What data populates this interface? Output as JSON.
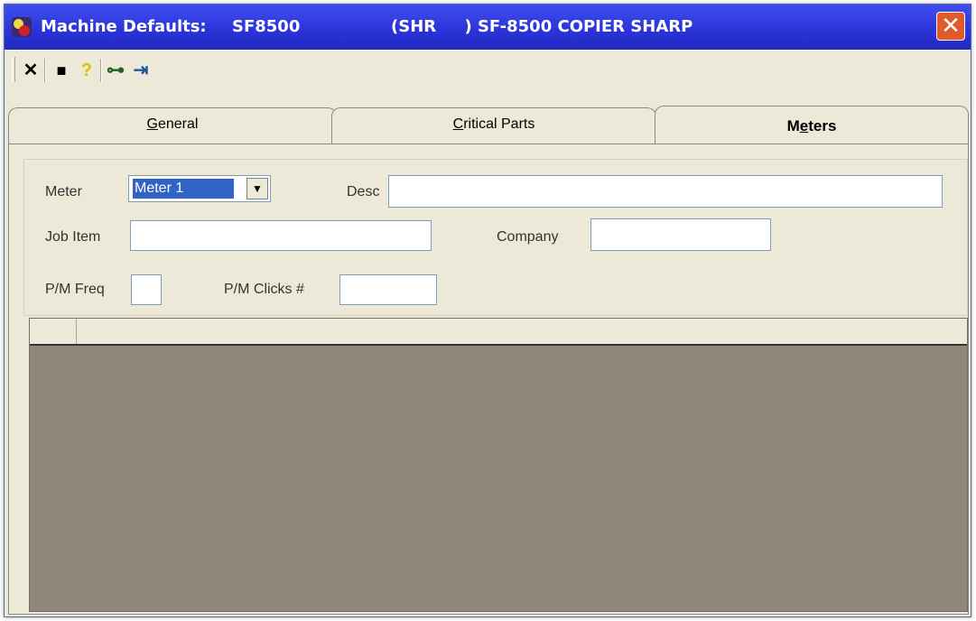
{
  "window": {
    "title_label": "Machine Defaults:",
    "machine_code": "SF8500",
    "machine_desc": "(SHR     ) SF-8500 COPIER SHARP",
    "close_glyph": "✕"
  },
  "toolbar": {
    "items": [
      {
        "name": "close-icon",
        "glyph": "✕",
        "color": "#000000"
      },
      {
        "name": "save-icon",
        "glyph": "■",
        "color": "#1a1a1a"
      },
      {
        "name": "help-icon",
        "glyph": "?",
        "color": "#e0c000"
      },
      {
        "name": "tree-icon",
        "glyph": "⊶",
        "color": "#206020"
      },
      {
        "name": "exit-icon",
        "glyph": "⇥",
        "color": "#1a5a9a"
      }
    ]
  },
  "tabs": [
    {
      "label": "General",
      "active": false
    },
    {
      "label": "Critical Parts",
      "active": false
    },
    {
      "label": "Meters",
      "active": true
    }
  ],
  "form": {
    "meter_label": "Meter",
    "meter_value": "Meter 1",
    "desc_label": "Desc",
    "desc_value": "",
    "job_item_label": "Job Item",
    "job_item_value": "",
    "company_label": "Company",
    "company_value": "",
    "pm_freq_label": "P/M Freq",
    "pm_freq_value": "",
    "pm_clicks_label": "P/M Clicks #",
    "pm_clicks_value": ""
  },
  "colors": {
    "titlebar": "#2a33d8",
    "grid_background": "#8f8779",
    "window_face": "#ece9d8"
  }
}
